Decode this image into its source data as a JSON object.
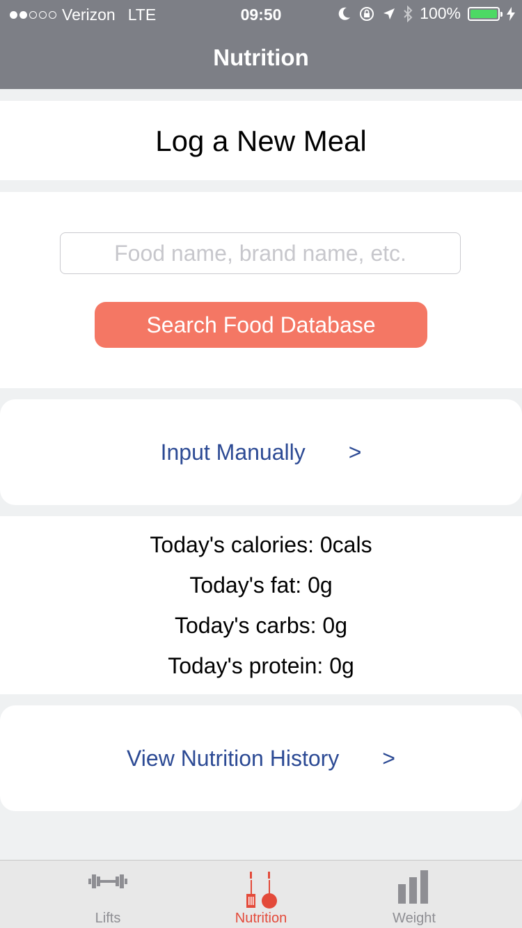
{
  "status_bar": {
    "carrier": "Verizon",
    "network": "LTE",
    "time": "09:50",
    "battery": "100%",
    "signal_bars_filled": 2,
    "signal_bars_total": 5
  },
  "nav": {
    "title": "Nutrition"
  },
  "log_card": {
    "title": "Log a New Meal"
  },
  "search": {
    "placeholder": "Food name, brand name, etc.",
    "value": "",
    "button_label": "Search Food Database"
  },
  "manual": {
    "label": "Input Manually",
    "chevron": ">"
  },
  "stats": {
    "calories": "Today's calories: 0cals",
    "fat": "Today's fat: 0g",
    "carbs": "Today's carbs: 0g",
    "protein": "Today's protein: 0g"
  },
  "history": {
    "label": "View Nutrition History",
    "chevron": ">"
  },
  "tabs": [
    {
      "label": "Lifts",
      "icon": "dumbbell-icon",
      "active": false
    },
    {
      "label": "Nutrition",
      "icon": "utensils-icon",
      "active": true
    },
    {
      "label": "Weight",
      "icon": "bar-chart-icon",
      "active": false
    }
  ],
  "colors": {
    "header": "#7d7f86",
    "accent_button": "#f47764",
    "link": "#2c4a94",
    "active_tab": "#e34a3a",
    "inactive_tab": "#8e8e93",
    "battery": "#4cd964"
  }
}
